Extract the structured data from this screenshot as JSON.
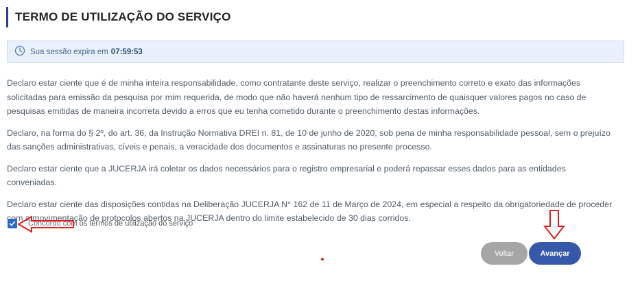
{
  "page": {
    "title": "TERMO DE UTILIZAÇÃO DO SERVIÇO"
  },
  "session": {
    "icon": "clock-icon",
    "label": "Sua sessão expira em",
    "time": "07:59:53"
  },
  "terms": {
    "paragraphs": [
      "Declaro estar ciente que é de minha inteira responsabilidade, como contratante deste serviço, realizar o preenchimento correto e exato das informações solicitadas para emissão da pesquisa por mim requerida, de modo que não haverá nenhum tipo de ressarcimento de quaisquer valores pagos no caso de pesquisas emitidas de maneira incorreta devido a erros que eu tenha cometido durante o preenchimento destas informações.",
      "Declaro, na forma do § 2º, do art. 36, da Instrução Normativa DREI n. 81, de 10 de junho de 2020, sob pena de minha responsabilidade pessoal, sem o prejuízo das sanções administrativas, cíveis e penais, a veracidade dos documentos e assinaturas no presente processo.",
      "Declaro estar ciente que a JUCERJA irá coletar os dados necessários para o registro empresarial e poderá repassar esses dados para as entidades conveniadas.",
      "Declaro estar ciente das disposições contidas na Deliberação JUCERJA N° 162 de 11 de Março de 2024, em especial a respeito da obrigatoriedade de proceder com a movimentação de protocolos abertos na JUCERJA dentro do limite estabelecido de 30 dias corridos."
    ]
  },
  "agreement": {
    "checked": true,
    "label": "Concordo com os termos de utilização do serviço"
  },
  "buttons": {
    "back": "Voltar",
    "next": "Avançar"
  },
  "annotations": {
    "color": "#e02020"
  }
}
